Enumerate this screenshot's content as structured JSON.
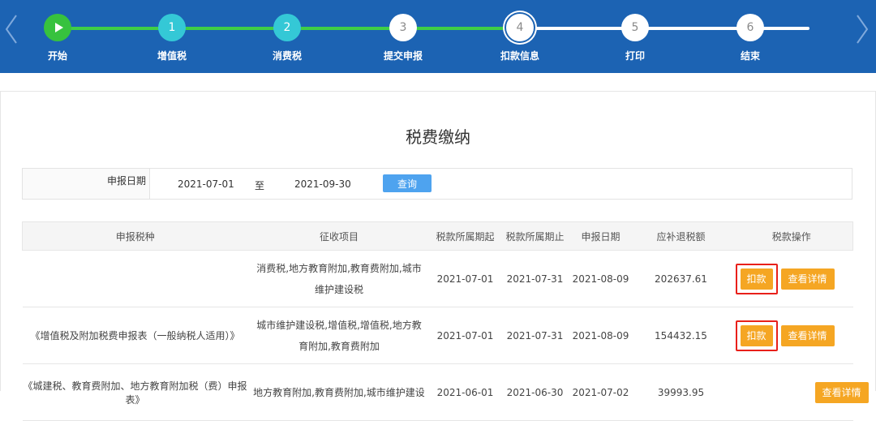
{
  "wizard": {
    "steps": [
      {
        "label": "开始",
        "number": "",
        "state": "start"
      },
      {
        "label": "增值税",
        "number": "1",
        "state": "done"
      },
      {
        "label": "消费税",
        "number": "2",
        "state": "done"
      },
      {
        "label": "提交申报",
        "number": "3",
        "state": "todo"
      },
      {
        "label": "扣款信息",
        "number": "4",
        "state": "current"
      },
      {
        "label": "打印",
        "number": "5",
        "state": "todo"
      },
      {
        "label": "结束",
        "number": "6",
        "state": "todo"
      }
    ],
    "colors": {
      "bar": "#1c63b3",
      "done_line": "#3fce46",
      "done_circle": "#34c8d6"
    }
  },
  "page": {
    "title": "税费缴纳"
  },
  "filter": {
    "label": "申报日期",
    "date_from": "2021-07-01",
    "separator": "至",
    "date_to": "2021-09-30",
    "query_label": "查询"
  },
  "table": {
    "headers": [
      "申报税种",
      "征收项目",
      "税款所属期起",
      "税款所属期止",
      "申报日期",
      "应补退税额",
      "税款操作"
    ],
    "rows": [
      {
        "tax_type": "",
        "items_line1": "消费税,地方教育附加,教育费附加,城市",
        "items_line2": "维护建设税",
        "period_start": "2021-07-01",
        "period_end": "2021-07-31",
        "filing_date": "2021-08-09",
        "amount": "202637.61",
        "deduct_label": "扣款",
        "detail_label": "查看详情"
      },
      {
        "tax_type": "《增值税及附加税费申报表（一般纳税人适用）》",
        "items_line1": "城市维护建设税,增值税,增值税,地方教",
        "items_line2": "育附加,教育费附加",
        "period_start": "2021-07-01",
        "period_end": "2021-07-31",
        "filing_date": "2021-08-09",
        "amount": "154432.15",
        "deduct_label": "扣款",
        "detail_label": "查看详情"
      },
      {
        "tax_type": "《城建税、教育费附加、地方教育附加税（费）申报表》",
        "items_line1": "地方教育附加,教育费附加,城市维护建设",
        "items_line2": "",
        "period_start": "2021-06-01",
        "period_end": "2021-06-30",
        "filing_date": "2021-07-02",
        "amount": "39993.95",
        "deduct_label": "",
        "detail_label": "查看详情"
      }
    ]
  }
}
